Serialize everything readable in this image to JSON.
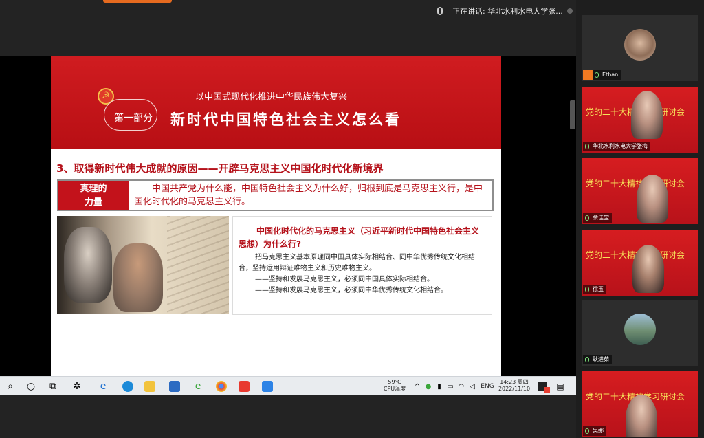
{
  "meeting": {
    "speaking_label": "正在讲话: 华北水利水电大学张..."
  },
  "slide": {
    "part_label": "第一部分",
    "subtitle": "以中国式现代化推进中华民族伟大复兴",
    "title": "新时代中国特色社会主义怎么看",
    "section_heading": "3、取得新时代伟大成就的原因——开辟马克思主义中国化时代化新境界",
    "truth_label_line1": "真理的",
    "truth_label_line2": "力量",
    "truth_text": "中国共产党为什么能，中国特色社会主义为什么好，归根到底是马克思主义行，是中国化时代化的马克思主义行。",
    "question": "中国化时代化的马克思主义（习近平新时代中国特色社会主义思想）为什么行?",
    "para1": "把马克思主义基本原理同中国具体实际相结合、同中华优秀传统文化相结合，坚持运用辩证唯物主义和历史唯物主义。",
    "para2": "——坚持和发展马克思主义，必须同中国具体实际相结合。",
    "para3": "——坚持和发展马克思主义，必须同中华优秀传统文化相结合。"
  },
  "taskbar": {
    "temp": "59℃",
    "temp_label": "CPU温度",
    "lang": "ENG",
    "time": "14:23 周四",
    "date": "2022/11/10",
    "badge": "1"
  },
  "participants": [
    {
      "name": "Ethan",
      "banner": ""
    },
    {
      "name": "华北水利水电大学张梅",
      "banner": "党的二十大精神学习研讨会"
    },
    {
      "name": "余佳宝",
      "banner": "党的二十大精神学习研讨会"
    },
    {
      "name": "徐玉",
      "banner": "党的二十大精神学习研讨会"
    },
    {
      "name": "耿进茹",
      "banner": ""
    },
    {
      "name": "吴娜",
      "banner": "党的二十大精神学习研讨会"
    }
  ],
  "colors": {
    "slide_red": "#c3121b",
    "banner_text_yellow": "#f7e25a"
  }
}
